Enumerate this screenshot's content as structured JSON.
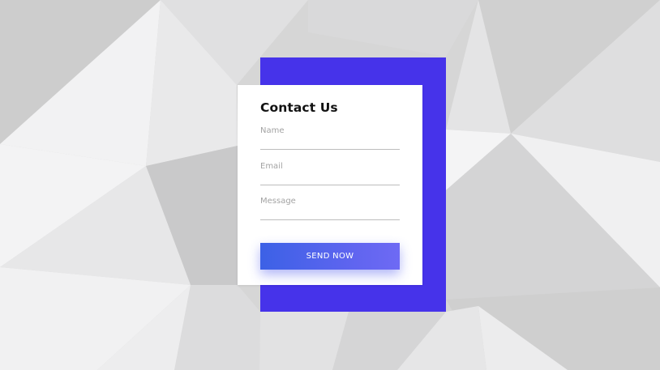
{
  "contact_form": {
    "title": "Contact Us",
    "fields": [
      {
        "label": "Name",
        "value": ""
      },
      {
        "label": "Email",
        "value": ""
      },
      {
        "label": "Message",
        "value": ""
      }
    ],
    "submit_label": "SEND NOW"
  },
  "colors": {
    "accent_panel": "#4633ea",
    "button_gradient_start": "#3c61e6",
    "button_gradient_end": "#6e6af4",
    "card_background": "#ffffff",
    "background_gray": "#d3d3d3"
  }
}
